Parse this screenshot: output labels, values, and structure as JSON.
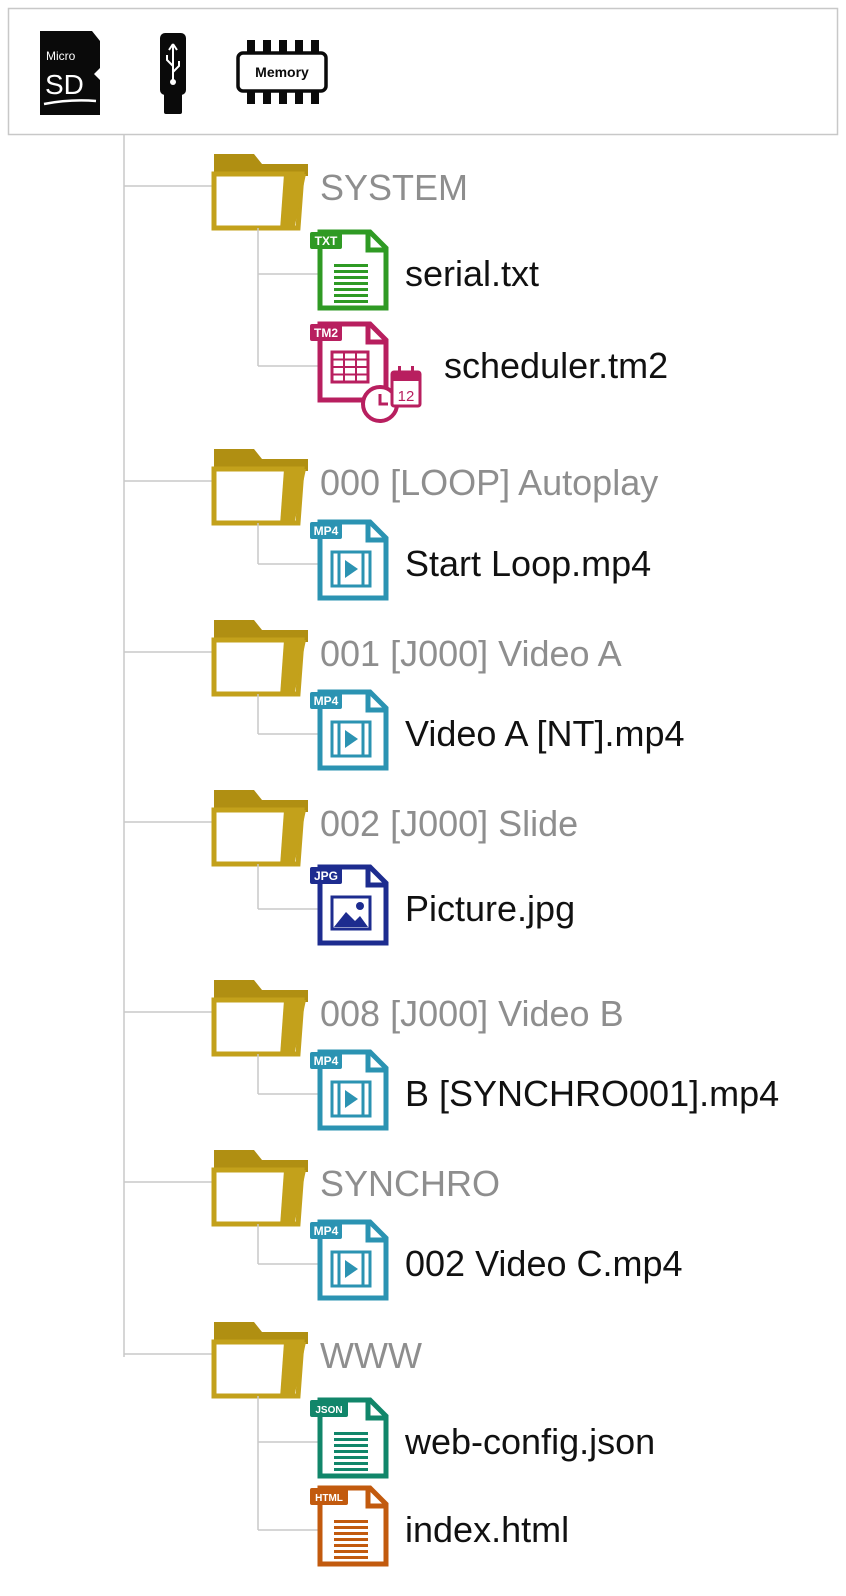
{
  "storage_bar": {
    "icons": [
      "microsd-card-icon",
      "usb-stick-icon",
      "memory-chip-icon"
    ],
    "microsd_text": {
      "top": "Micro",
      "main": "SD"
    },
    "memory_text": "Memory"
  },
  "colors": {
    "folder": "#c3a11b",
    "folder_dark": "#b08f12",
    "txt": "#2f9a24",
    "tm2": "#b81f5f",
    "mp4": "#2b93b2",
    "jpg": "#1d2c8f",
    "json": "#11866a",
    "html": "#c25a0e",
    "connector": "#c9c9c9",
    "folder_label": "#8e8e8e",
    "file_label": "#111111"
  },
  "tree": {
    "folders": [
      {
        "name": "SYSTEM",
        "files": [
          {
            "name": "serial.txt",
            "kind": "txt",
            "badge": "TXT"
          },
          {
            "name": "scheduler.tm2",
            "kind": "tm2",
            "badge": "TM2",
            "calendar_day": "12"
          }
        ]
      },
      {
        "name": "000 [LOOP] Autoplay",
        "files": [
          {
            "name": "Start Loop.mp4",
            "kind": "mp4",
            "badge": "MP4"
          }
        ]
      },
      {
        "name": "001 [J000] Video A",
        "files": [
          {
            "name": "Video A [NT].mp4",
            "kind": "mp4",
            "badge": "MP4"
          }
        ]
      },
      {
        "name": "002 [J000] Slide",
        "files": [
          {
            "name": "Picture.jpg",
            "kind": "jpg",
            "badge": "JPG"
          }
        ]
      },
      {
        "name": "008 [J000] Video B",
        "files": [
          {
            "name": "B [SYNCHRO001].mp4",
            "kind": "mp4",
            "badge": "MP4"
          }
        ]
      },
      {
        "name": "SYNCHRO",
        "files": [
          {
            "name": "002 Video C.mp4",
            "kind": "mp4",
            "badge": "MP4"
          }
        ]
      },
      {
        "name": "WWW",
        "files": [
          {
            "name": "web-config.json",
            "kind": "json",
            "badge": "JSON"
          },
          {
            "name": "index.html",
            "kind": "html",
            "badge": "HTML"
          }
        ]
      }
    ]
  }
}
